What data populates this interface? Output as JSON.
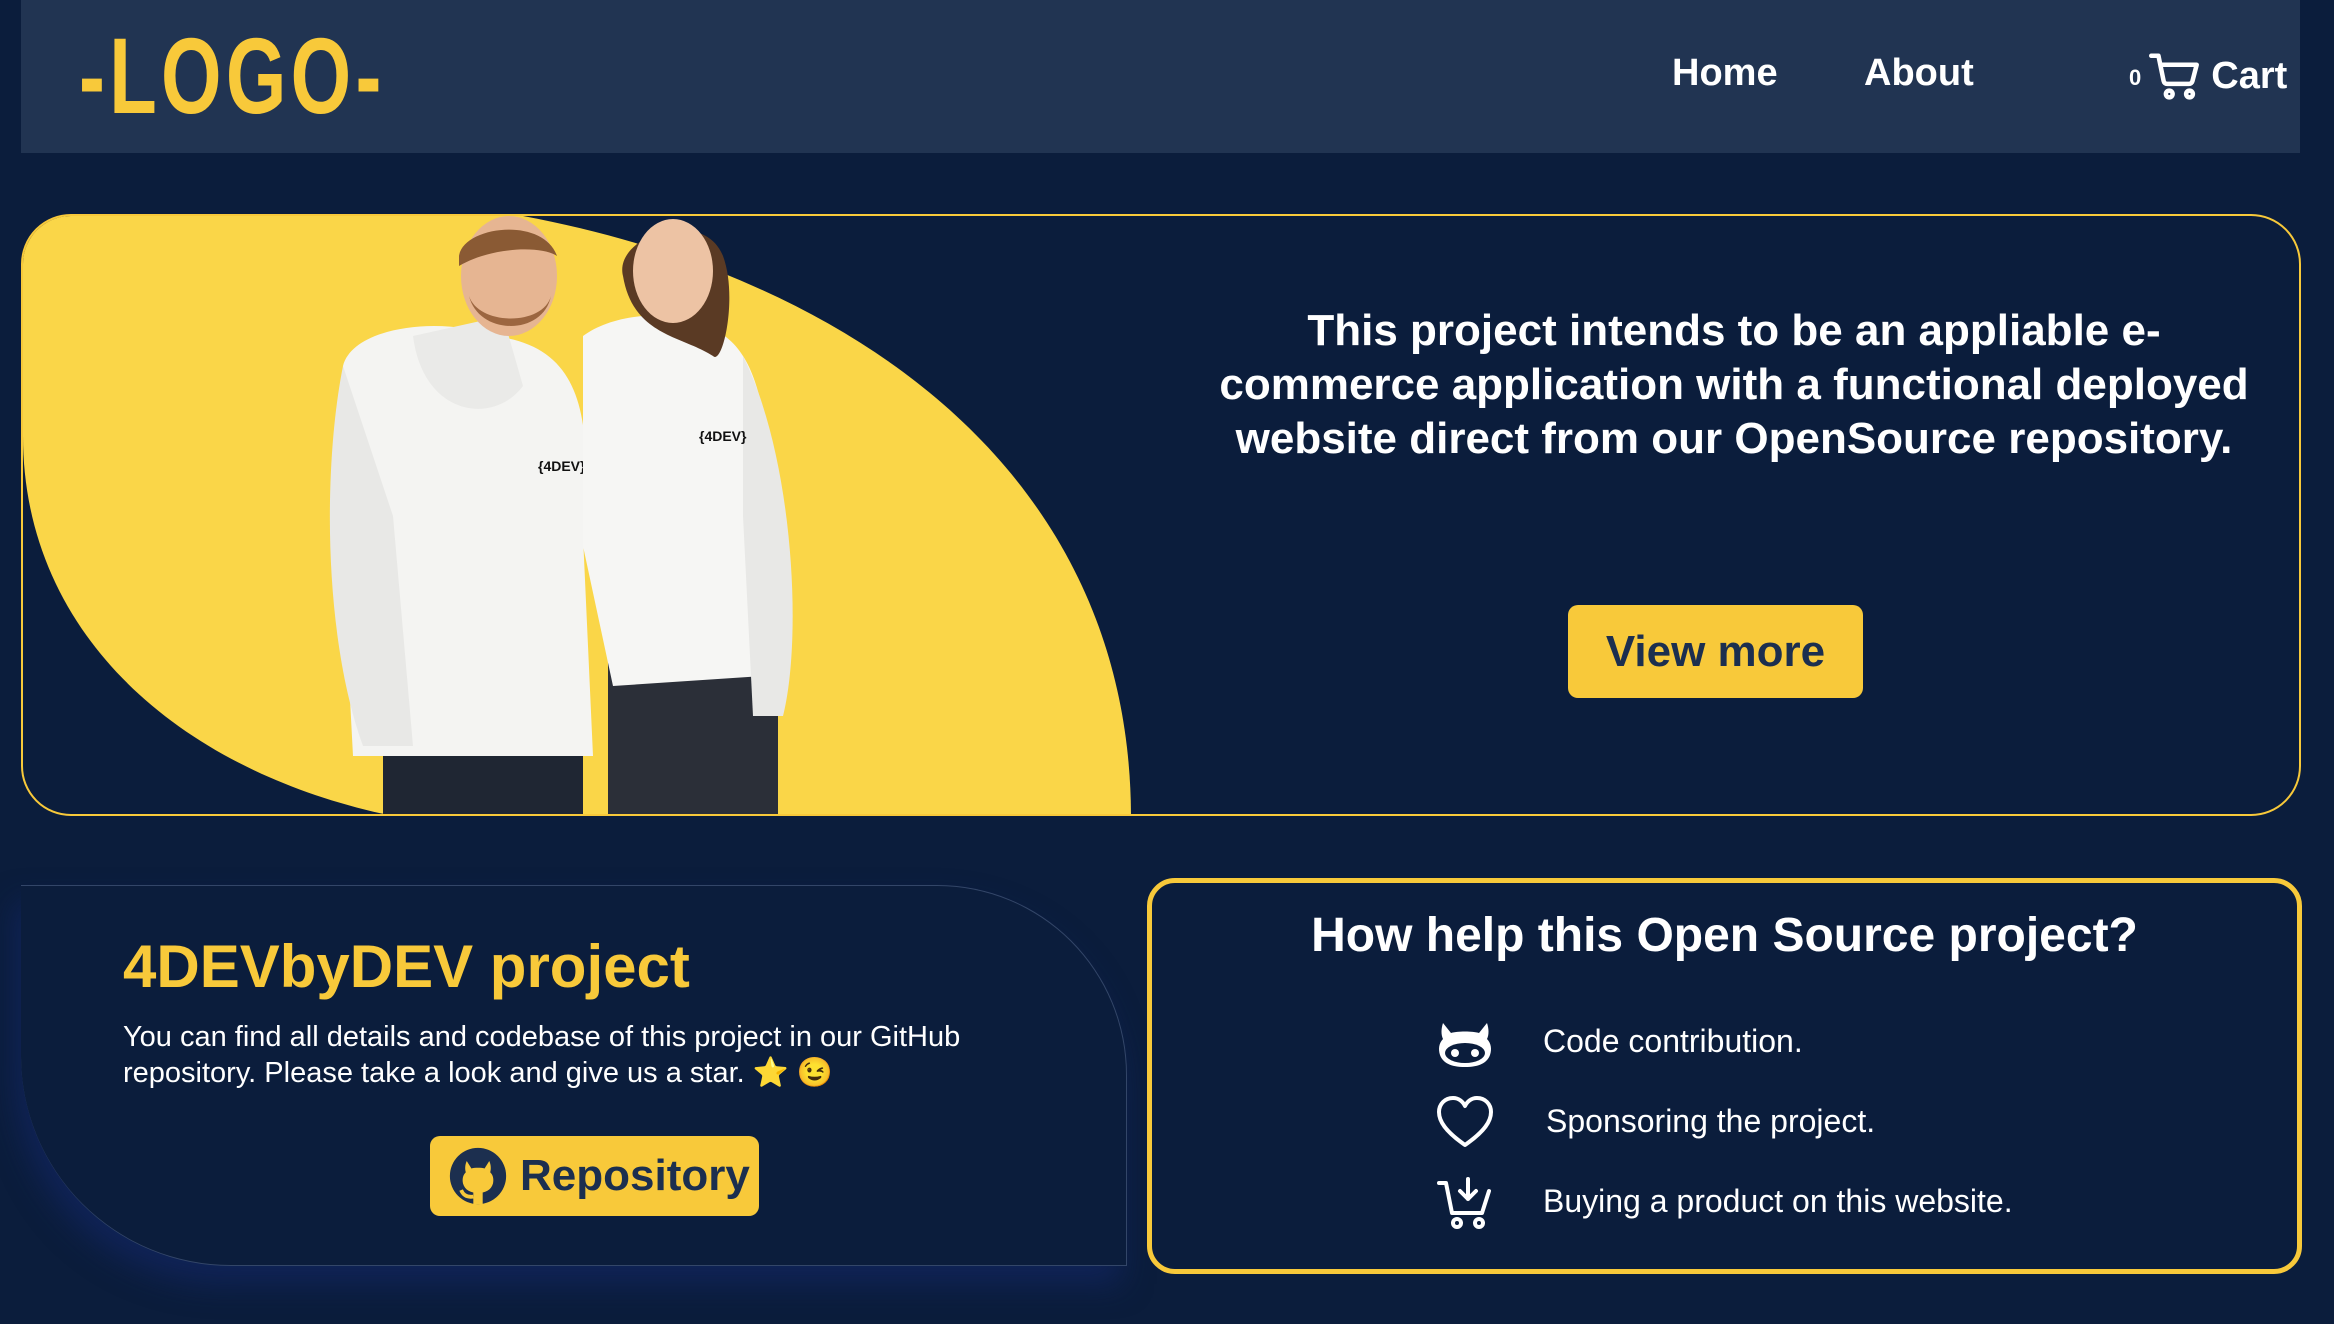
{
  "header": {
    "logo": "-LOGO-",
    "nav": {
      "home": "Home",
      "about": "About"
    },
    "cart": {
      "count": "0",
      "label": "Cart",
      "icon": "cart-icon"
    }
  },
  "hero": {
    "description": "This project intends to be an appliable e-commerce application with a functional deployed website direct from our OpenSource repository.",
    "button_label": "View more",
    "image": "two people wearing white 4DEVbyDEV hoodies"
  },
  "project": {
    "title": "4DEVbyDEV project",
    "text": "You can find all details and codebase of this project in our GitHub repository. Please take a look and give us a star. ⭐ 😉",
    "button_label": "Repository",
    "button_icon": "github-icon"
  },
  "help": {
    "title": "How help this Open Source project?",
    "items": [
      {
        "icon": "github-icon",
        "label": "Code contribution."
      },
      {
        "icon": "heart-icon",
        "label": "Sponsoring the project."
      },
      {
        "icon": "cart-download-icon",
        "label": "Buying a product on this website."
      }
    ]
  },
  "colors": {
    "background": "#0b1d3c",
    "header": "#213452",
    "accent": "#f8c93a",
    "button_text": "#1c2f4f"
  }
}
